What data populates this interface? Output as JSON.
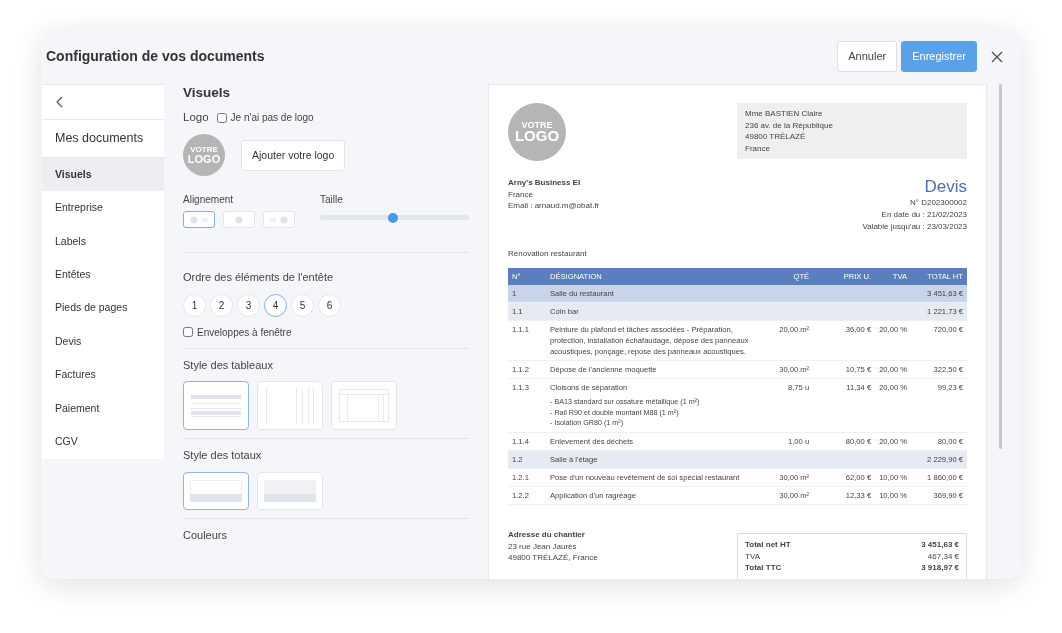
{
  "window": {
    "title": "Configuration de vos documents"
  },
  "header_buttons": [
    {
      "kind": "secondary",
      "label": "Annuler"
    },
    {
      "kind": "primary",
      "label": "Enregistrer"
    }
  ],
  "sidebar": {
    "heading": "Mes documents",
    "items": [
      {
        "label": "Visuels",
        "selected": true
      },
      {
        "label": "Entreprise",
        "selected": false
      },
      {
        "label": "Labels",
        "selected": false
      },
      {
        "label": "Entêtes",
        "selected": false
      },
      {
        "label": "Pieds de pages",
        "selected": false
      },
      {
        "label": "Devis",
        "selected": false
      },
      {
        "label": "Factures",
        "selected": false
      },
      {
        "label": "Paiement",
        "selected": false
      },
      {
        "label": "CGV",
        "selected": false
      }
    ]
  },
  "settings": {
    "title": "Visuels",
    "logo": {
      "label": "Logo",
      "no_logo": {
        "label": "Je n'ai pas de logo",
        "checked": false
      },
      "placeholder_lines": [
        "VOTRE",
        "LOGO"
      ],
      "add_button": "Ajouter votre logo"
    },
    "alignment": {
      "label": "Alignement",
      "options": [
        {
          "kind": "left",
          "selected": true
        },
        {
          "kind": "center",
          "selected": false
        },
        {
          "kind": "right",
          "selected": false
        }
      ]
    },
    "size": {
      "label": "Taille",
      "level": 0.49
    },
    "header_order": {
      "label": "Ordre des éléments de l'entête",
      "steps": [
        {
          "label": "1",
          "selected": false
        },
        {
          "label": "2",
          "selected": false
        },
        {
          "label": "3",
          "selected": false
        },
        {
          "label": "4",
          "selected": true
        },
        {
          "label": "5",
          "selected": false
        },
        {
          "label": "6",
          "selected": false
        }
      ]
    },
    "envelopes": {
      "label": "Enveloppes à fenêtre",
      "checked": false
    },
    "table_styles": {
      "label": "Style des tableaux",
      "options": [
        {
          "kind": "rows",
          "selected": true
        },
        {
          "kind": "columns",
          "selected": false
        },
        {
          "kind": "grid",
          "selected": false
        }
      ]
    },
    "totals_styles": {
      "label": "Style des totaux",
      "options": [
        {
          "kind": "plain",
          "selected": true
        },
        {
          "kind": "shaded",
          "selected": false
        }
      ]
    },
    "colors": {
      "label": "Couleurs"
    }
  },
  "preview": {
    "logo_lines": [
      "VOTRE",
      "LOGO"
    ],
    "recipient": [
      "Mme BASTIEN Claire",
      "236 av. de la République",
      "49800 TRÉLAZÉ",
      "France"
    ],
    "company": [
      "Arny's Business EI",
      "France",
      "Email : arnaud.m@obat.fr"
    ],
    "doc_title": "Devis",
    "doc_meta": [
      "N° D202300002",
      "En date du : 21/02/2023",
      "Valable jusqu'au : 23/03/2023"
    ],
    "subject": "Rénovation restaurant",
    "table": {
      "columns": [
        "N°",
        "DÉSIGNATION",
        "QTÉ",
        "PRIX U.",
        "TVA",
        "TOTAL HT"
      ],
      "rows": [
        {
          "kind": "section",
          "cells": [
            "1",
            "Salle du restaurant",
            "",
            "",
            "",
            "3 451,63 €"
          ]
        },
        {
          "kind": "subsection",
          "cells": [
            "1.1",
            "Coin bar",
            "",
            "",
            "",
            "1 221,73 €"
          ]
        },
        {
          "kind": "item",
          "cells": [
            "1.1.1",
            "Peinture du plafond et tâches associées - Préparation, protection, installation échafaudage, dépose des panneaux acoustiques, ponçage, repose des panneaux acoustiques.",
            "20,00 m²",
            "36,00 €",
            "20,00 %",
            "720,00 €"
          ]
        },
        {
          "kind": "item",
          "cells": [
            "1.1.2",
            "Dépose de l'ancienne moquette",
            "30,00 m²",
            "10,75 €",
            "20,00 %",
            "322,50 €"
          ]
        },
        {
          "kind": "item",
          "cells": [
            "1.1.3",
            "Cloisons de séparation",
            "8,75 u",
            "11,34 €",
            "20,00 %",
            "99,23 €"
          ],
          "details": [
            "- BA13 standard sur ossature métallique (1 m²)",
            "- Rail R90 et double montant M88 (1 m²)",
            "- Isolation GR80 (1 m²)"
          ]
        },
        {
          "kind": "item",
          "cells": [
            "1.1.4",
            "Enlevement des déchets",
            "1,00 u",
            "80,00 €",
            "20,00 %",
            "80,00 €"
          ]
        },
        {
          "kind": "subsection",
          "cells": [
            "1.2",
            "Salle à l'étage",
            "",
            "",
            "",
            "2 229,90 €"
          ]
        },
        {
          "kind": "item",
          "cells": [
            "1.2.1",
            "Pose d'un nouveau revêtement de sol spécial restaurant",
            "30,00 m²",
            "62,00 €",
            "10,00 %",
            "1 860,00 €"
          ]
        },
        {
          "kind": "item",
          "cells": [
            "1.2.2",
            "Application d'un ragréage",
            "30,00 m²",
            "12,33 €",
            "10,00 %",
            "369,90 €"
          ]
        }
      ]
    },
    "site_address": {
      "label": "Adresse du chantier",
      "lines": [
        "23 rue Jean Jaurès",
        "49800 TRÉLAZÉ, France"
      ]
    },
    "totals": [
      {
        "label": "Total net HT",
        "value": "3 451,63 €",
        "bold": true
      },
      {
        "label": "TVA",
        "value": "467,34 €",
        "bold": false
      },
      {
        "label": "Total TTC",
        "value": "3 918,97 €",
        "bold": true
      }
    ]
  }
}
